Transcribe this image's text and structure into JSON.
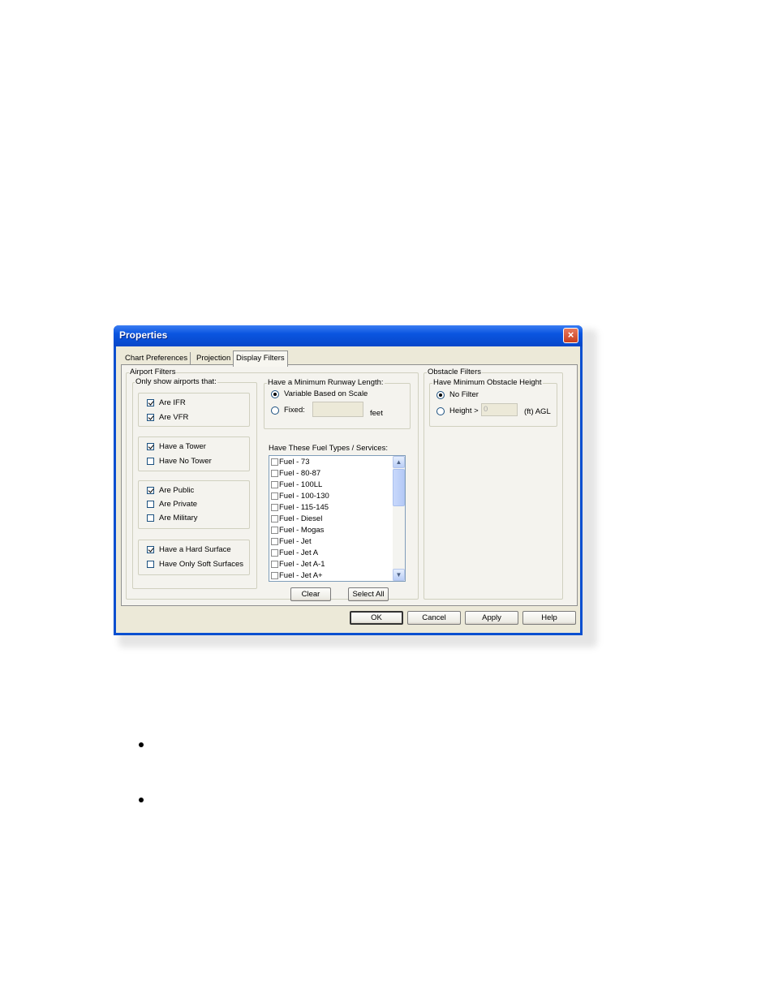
{
  "dialog": {
    "title": "Properties",
    "close_icon": "×",
    "tabs": [
      {
        "label": "Chart Preferences",
        "active": false
      },
      {
        "label": "Projection",
        "active": false
      },
      {
        "label": "Display Filters",
        "active": true
      }
    ],
    "airport_filters": {
      "legend": "Airport Filters",
      "only_show": {
        "legend": "Only show airports that:",
        "groups": [
          [
            {
              "label": "Are IFR",
              "checked": true
            },
            {
              "label": "Are VFR",
              "checked": true
            }
          ],
          [
            {
              "label": "Have a Tower",
              "checked": true
            },
            {
              "label": "Have No Tower",
              "checked": false
            }
          ],
          [
            {
              "label": "Are Public",
              "checked": true
            },
            {
              "label": "Are Private",
              "checked": false
            },
            {
              "label": "Are Military",
              "checked": false
            }
          ],
          [
            {
              "label": "Have a Hard Surface",
              "checked": true
            },
            {
              "label": "Have Only Soft Surfaces",
              "checked": false
            }
          ]
        ]
      },
      "runway": {
        "legend": "Have a Minimum Runway Length:",
        "option_variable": "Variable Based on Scale",
        "option_fixed": "Fixed:",
        "fixed_value": "",
        "unit": "feet",
        "selected": "variable"
      },
      "fuel": {
        "label": "Have These Fuel Types / Services:",
        "items": [
          {
            "label": "Fuel - 73",
            "checked": false
          },
          {
            "label": "Fuel - 80-87",
            "checked": false
          },
          {
            "label": "Fuel - 100LL",
            "checked": false
          },
          {
            "label": "Fuel - 100-130",
            "checked": false
          },
          {
            "label": "Fuel - 115-145",
            "checked": false
          },
          {
            "label": "Fuel - Diesel",
            "checked": false
          },
          {
            "label": "Fuel - Mogas",
            "checked": false
          },
          {
            "label": "Fuel - Jet",
            "checked": false
          },
          {
            "label": "Fuel - Jet A",
            "checked": false
          },
          {
            "label": "Fuel - Jet A-1",
            "checked": false
          },
          {
            "label": "Fuel - Jet A+",
            "checked": false
          }
        ],
        "scroll_up_icon": "▲",
        "scroll_down_icon": "▼",
        "clear_label": "Clear",
        "select_all_label": "Select All"
      }
    },
    "obstacle_filters": {
      "legend": "Obstacle Filters",
      "min_height": {
        "legend": "Have Minimum Obstacle Height",
        "option_no_filter": "No Filter",
        "option_height": "Height >",
        "height_value": "0",
        "unit": "(ft) AGL",
        "selected": "no_filter"
      }
    },
    "buttons": {
      "ok": "OK",
      "cancel": "Cancel",
      "apply": "Apply",
      "help": "Help"
    }
  }
}
